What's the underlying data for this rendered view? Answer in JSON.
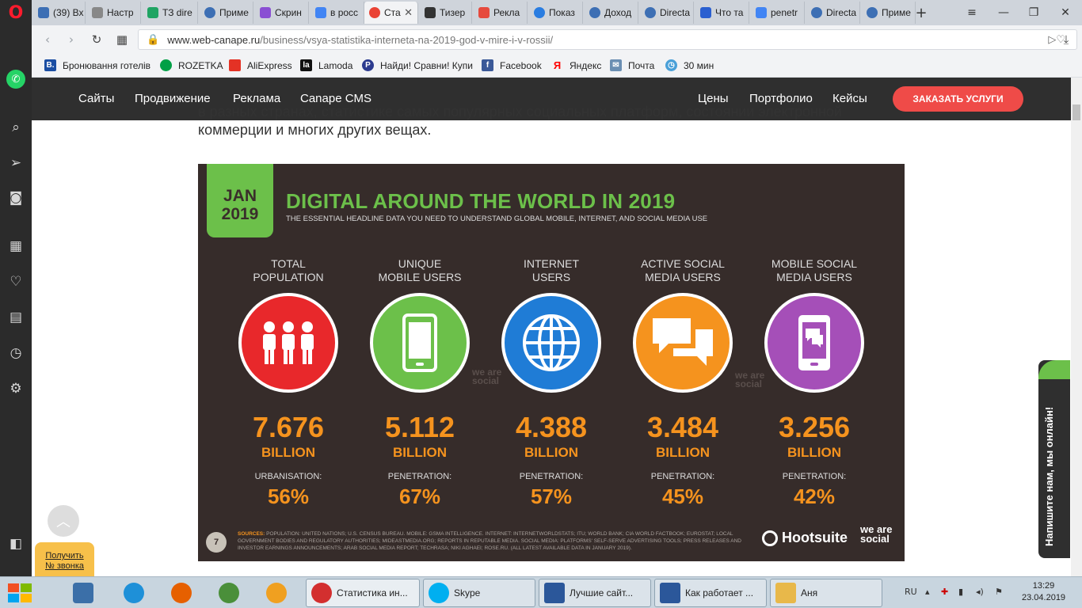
{
  "browser": {
    "tabs": [
      {
        "label": "(39) Вх",
        "color": "#3d6fb4"
      },
      {
        "label": "Настр",
        "color": "#888888"
      },
      {
        "label": "ТЗ dire",
        "color": "#1fa463"
      },
      {
        "label": "Приме",
        "color": "#3d6fb4"
      },
      {
        "label": "Скрин",
        "color": "#8a4fd3"
      },
      {
        "label": "в росс",
        "color": "#4285f4"
      },
      {
        "label": "Ста",
        "color": "#ea4335"
      },
      {
        "label": "Тизер",
        "color": "#333333"
      },
      {
        "label": "Рекла",
        "color": "#e64a3d"
      },
      {
        "label": "Показ",
        "color": "#2a7de1"
      },
      {
        "label": "Доход",
        "color": "#3d6fb4"
      },
      {
        "label": "Directa",
        "color": "#3d6fb4"
      },
      {
        "label": "Что та",
        "color": "#2a5fd0"
      },
      {
        "label": "penetr",
        "color": "#4285f4"
      },
      {
        "label": "Directa",
        "color": "#3d6fb4"
      },
      {
        "label": "Приме",
        "color": "#3d6fb4"
      }
    ],
    "url_host": "www.web-canape.ru",
    "url_path": "/business/vsya-statistika-interneta-na-2019-god-v-mire-i-v-rossii/",
    "bookmarks": [
      {
        "label": "Бронювання готелів",
        "icon": "B.",
        "color": "#1b4ea3"
      },
      {
        "label": "ROZETKA",
        "icon": "",
        "color": "#00a046"
      },
      {
        "label": "AliExpress",
        "icon": "",
        "color": "#e43225"
      },
      {
        "label": "Lamoda",
        "icon": "la",
        "color": "#111111"
      },
      {
        "label": "Найди! Сравни! Купи",
        "icon": "P",
        "color": "#2b3a8f"
      },
      {
        "label": "Facebook",
        "icon": "f",
        "color": "#3b5998"
      },
      {
        "label": "Яндекс",
        "icon": "Я",
        "color": "#ff0000"
      },
      {
        "label": "Почта",
        "icon": "✉",
        "color": "#6b8fb3"
      },
      {
        "label": "30 мин",
        "icon": "◷",
        "color": "#4aa0d8"
      }
    ]
  },
  "site_nav": {
    "left": [
      "Сайты",
      "Продвижение",
      "Реклама",
      "Canape CMS"
    ],
    "right": [
      "Цены",
      "Портфолио",
      "Кейсы"
    ],
    "order_button": "Заказать услуги"
  },
  "article": {
    "paragraph_line1": "в разных странах, статистике самых популярных социальных платформ, состоянии электронной",
    "paragraph_line2": "коммерции и многих других вещах."
  },
  "infographic": {
    "badge_month": "JAN",
    "badge_year": "2019",
    "title": "DIGITAL AROUND THE WORLD IN 2019",
    "subtitle": "THE ESSENTIAL HEADLINE DATA YOU NEED TO UNDERSTAND GLOBAL MOBILE, INTERNET, AND SOCIAL MEDIA USE",
    "stats": [
      {
        "label1": "TOTAL",
        "label2": "POPULATION",
        "value": "7.676",
        "unit": "BILLION",
        "metric": "URBANISATION:",
        "percent": "56%",
        "color": "#e8282b",
        "icon": "people-icon"
      },
      {
        "label1": "UNIQUE",
        "label2": "MOBILE USERS",
        "value": "5.112",
        "unit": "BILLION",
        "metric": "PENETRATION:",
        "percent": "67%",
        "color": "#6cc04a",
        "icon": "mobile-phone-icon"
      },
      {
        "label1": "INTERNET",
        "label2": "USERS",
        "value": "4.388",
        "unit": "BILLION",
        "metric": "PENETRATION:",
        "percent": "57%",
        "color": "#1f7cd6",
        "icon": "globe-icon"
      },
      {
        "label1": "ACTIVE SOCIAL",
        "label2": "MEDIA USERS",
        "value": "3.484",
        "unit": "BILLION",
        "metric": "PENETRATION:",
        "percent": "45%",
        "color": "#f5931e",
        "icon": "chat-bubbles-icon"
      },
      {
        "label1": "MOBILE SOCIAL",
        "label2": "MEDIA USERS",
        "value": "3.256",
        "unit": "BILLION",
        "metric": "PENETRATION:",
        "percent": "42%",
        "color": "#a54fb8",
        "icon": "mobile-chat-icon"
      }
    ],
    "watermark": "we are social",
    "slide_number": "7",
    "sources_label": "SOURCES:",
    "sources_text": "POPULATION: UNITED NATIONS; U.S. CENSUS BUREAU. MOBILE: GSMA INTELLIGENCE. INTERNET: INTERNETWORLDSTATS; ITU; WORLD BANK; CIA WORLD FACTBOOK; EUROSTAT; LOCAL GOVERNMENT BODIES AND REGULATORY AUTHORITIES; MIDEASTMEDIA.ORG; REPORTS IN REPUTABLE MEDIA. SOCIAL MEDIA: PLATFORMS' SELF-SERVE ADVERTISING TOOLS; PRESS RELEASES AND INVESTOR EARNINGS ANNOUNCEMENTS; ARAB SOCIAL MEDIA REPORT; TECHRASA; NIKI AGHAEI; ROSE.RU. (ALL LATEST AVAILABLE DATA IN JANUARY 2019).",
    "hootsuite": "Hootsuite",
    "we_are_social": "we are social"
  },
  "widgets": {
    "chat_text": "Напишите нам, мы онлайн!",
    "callback_line1": "Получить",
    "callback_line2": "№ звонка"
  },
  "taskbar": {
    "windows": [
      {
        "label": "Статистика ин...",
        "color": "#d32f2f"
      },
      {
        "label": "Skype",
        "color": "#00aff0"
      },
      {
        "label": "Лучшие сайт...",
        "color": "#2b579a"
      },
      {
        "label": "Как работает ...",
        "color": "#2b579a"
      },
      {
        "label": "Аня",
        "color": "#e8b84a"
      }
    ],
    "lang": "RU",
    "time": "13:29",
    "date": "23.04.2019"
  }
}
